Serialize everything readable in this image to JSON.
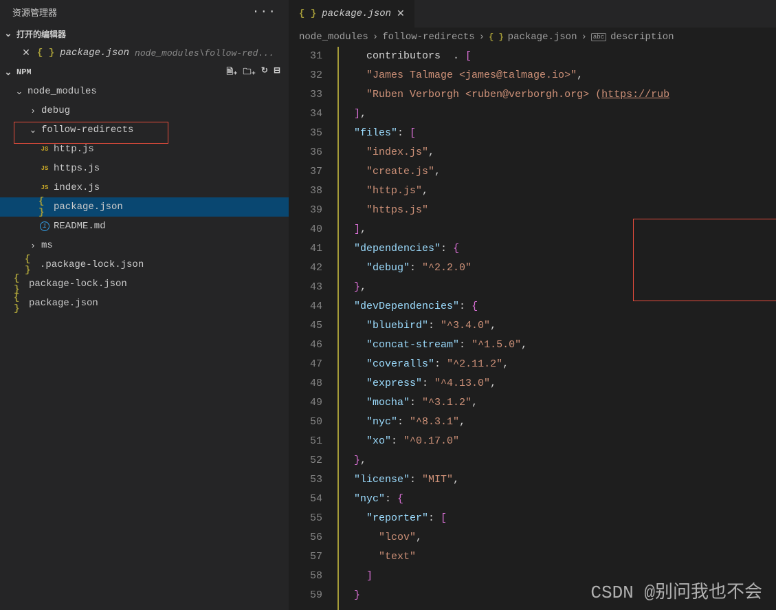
{
  "sidebar": {
    "title": "资源管理器",
    "openEditors": "打开的编辑器",
    "openFile": {
      "name": "package.json",
      "path": "node_modules\\follow-red..."
    },
    "npm": "NPM",
    "tree": {
      "node_modules": "node_modules",
      "debug": "debug",
      "follow_redirects": "follow-redirects",
      "http_js": "http.js",
      "https_js": "https.js",
      "index_js": "index.js",
      "package_json": "package.json",
      "readme": "README.md",
      "ms": "ms",
      "pkg_lock_dot": ".package-lock.json",
      "pkg_lock": "package-lock.json",
      "root_pkg": "package.json"
    }
  },
  "tab": {
    "name": "package.json"
  },
  "breadcrumb": {
    "p1": "node_modules",
    "p2": "follow-redirects",
    "p3": "package.json",
    "p4": "description"
  },
  "code": {
    "lines": [
      31,
      32,
      33,
      34,
      35,
      36,
      37,
      38,
      39,
      40,
      41,
      42,
      43,
      44,
      45,
      46,
      47,
      48,
      49,
      50,
      51,
      52,
      53,
      54,
      55,
      56,
      57,
      58,
      59
    ],
    "l31": "    contributors  : [",
    "l32_a": "\"James Talmage <james@talmage.io>\"",
    "l33_a": "\"Ruben Verborgh <ruben@verborgh.org> (",
    "l33_b": "https://rub",
    "l35_k": "\"files\"",
    "l36": "\"index.js\"",
    "l37": "\"create.js\"",
    "l38": "\"http.js\"",
    "l39": "\"https.js\"",
    "l41_k": "\"dependencies\"",
    "l42_k": "\"debug\"",
    "l42_v": "\"^2.2.0\"",
    "l44_k": "\"devDependencies\"",
    "l45_k": "\"bluebird\"",
    "l45_v": "\"^3.4.0\"",
    "l46_k": "\"concat-stream\"",
    "l46_v": "\"^1.5.0\"",
    "l47_k": "\"coveralls\"",
    "l47_v": "\"^2.11.2\"",
    "l48_k": "\"express\"",
    "l48_v": "\"^4.13.0\"",
    "l49_k": "\"mocha\"",
    "l49_v": "\"^3.1.2\"",
    "l50_k": "\"nyc\"",
    "l50_v": "\"^8.3.1\"",
    "l51_k": "\"xo\"",
    "l51_v": "\"^0.17.0\"",
    "l53_k": "\"license\"",
    "l53_v": "\"MIT\"",
    "l54_k": "\"nyc\"",
    "l55_k": "\"reporter\"",
    "l56": "\"lcov\"",
    "l57": "\"text\""
  },
  "watermark": "CSDN @别问我也不会"
}
